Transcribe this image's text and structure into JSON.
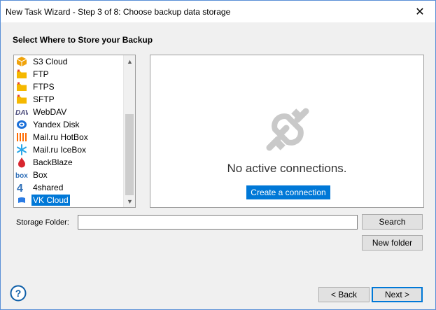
{
  "window": {
    "title": "New Task Wizard - Step 3 of 8: Choose backup data storage",
    "close_glyph": "✕"
  },
  "section_title": "Select Where to Store your Backup",
  "storage_list": {
    "items": [
      {
        "label": "S3 Cloud",
        "icon": "s3-cloud-icon",
        "color": "#f0a30a"
      },
      {
        "label": "FTP",
        "icon": "ftp-folder-icon",
        "color": "#f5b800"
      },
      {
        "label": "FTPS",
        "icon": "ftps-folder-icon",
        "color": "#f5b800"
      },
      {
        "label": "SFTP",
        "icon": "sftp-folder-icon",
        "color": "#f5b800"
      },
      {
        "label": "WebDAV",
        "icon": "webdav-icon",
        "color": "#4a4a7a"
      },
      {
        "label": "Yandex Disk",
        "icon": "yandex-disk-icon",
        "color": "#1a6fd8"
      },
      {
        "label": "Mail.ru HotBox",
        "icon": "hotbox-icon",
        "color": "#ff6a00"
      },
      {
        "label": "Mail.ru IceBox",
        "icon": "icebox-icon",
        "color": "#2aa7e8"
      },
      {
        "label": "BackBlaze",
        "icon": "backblaze-icon",
        "color": "#d8262f"
      },
      {
        "label": "Box",
        "icon": "box-icon",
        "color": "#2f6fb8"
      },
      {
        "label": "4shared",
        "icon": "4shared-icon",
        "color": "#2f6fb8"
      },
      {
        "label": "VK Cloud",
        "icon": "vk-cloud-icon",
        "color": "#2a7be4"
      }
    ],
    "selected": "VK Cloud",
    "scroll_up_glyph": "▲",
    "scroll_down_glyph": "▼"
  },
  "connections": {
    "empty_text": "No active connections.",
    "create_button": "Create a connection",
    "icon": "plug-icon"
  },
  "storage_folder": {
    "label": "Storage Folder:",
    "value": "",
    "search_button": "Search",
    "new_folder_button": "New folder"
  },
  "footer": {
    "help_glyph": "?",
    "back_button": "< Back",
    "next_button": "Next >"
  },
  "colors": {
    "accent": "#0078d7",
    "window_border": "#5a8fd6",
    "dialog_bg": "#f0f0f0"
  }
}
